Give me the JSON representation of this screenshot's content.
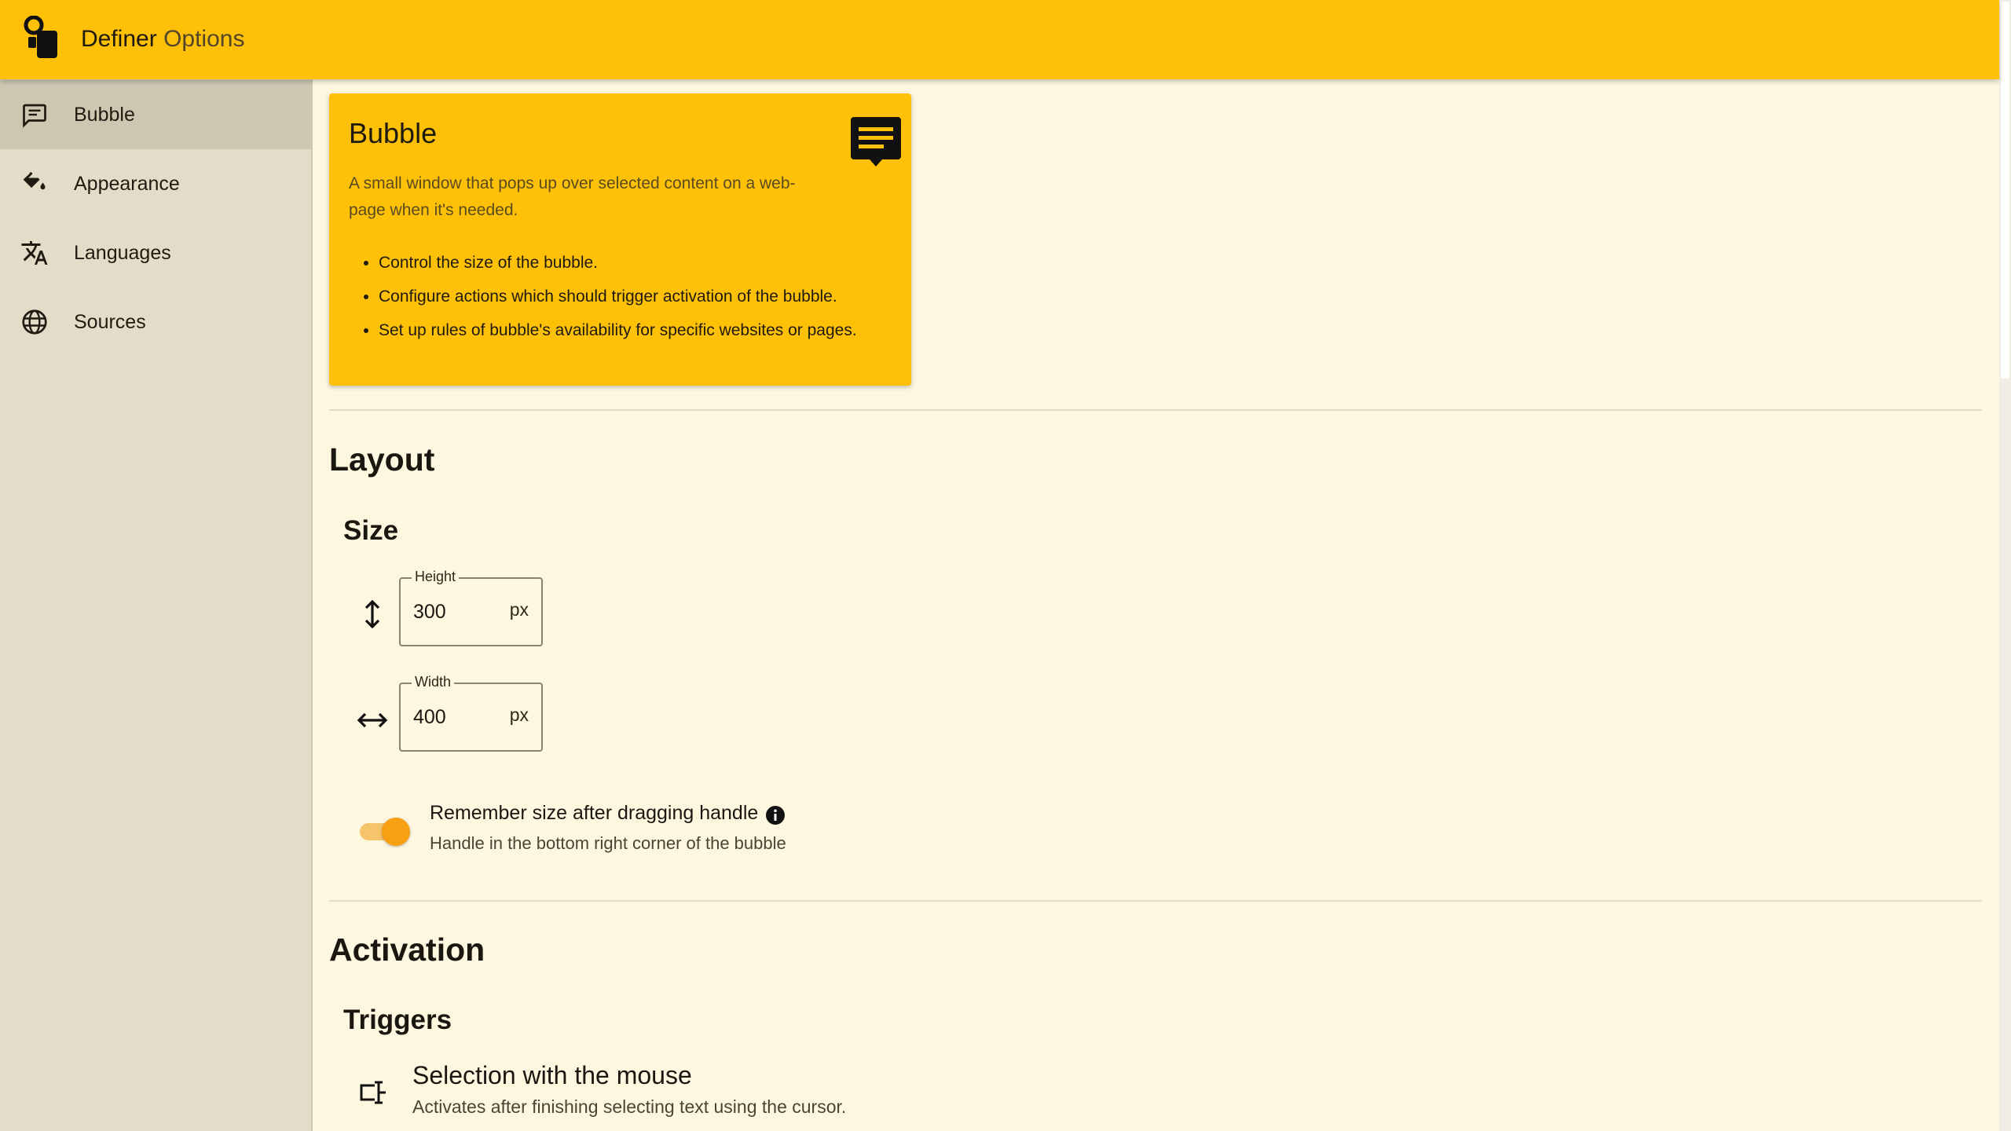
{
  "app": {
    "name": "Definer",
    "section": "Options"
  },
  "sidebar": {
    "items": [
      {
        "label": "Bubble",
        "icon": "chat-bubble-icon",
        "active": true
      },
      {
        "label": "Appearance",
        "icon": "paint-bucket-icon",
        "active": false
      },
      {
        "label": "Languages",
        "icon": "translate-icon",
        "active": false
      },
      {
        "label": "Sources",
        "icon": "globe-icon",
        "active": false
      }
    ]
  },
  "intro": {
    "title": "Bubble",
    "description": "A small window that pops up over selected content on a web-page when it's needed.",
    "icon": "chat-bubble-icon",
    "bullets": [
      "Control the size of the bubble.",
      "Configure actions which should trigger activation of the bubble.",
      "Set up rules of bubble's availability for specific websites or pages."
    ]
  },
  "layout": {
    "heading": "Layout",
    "size": {
      "heading": "Size",
      "height": {
        "label": "Height",
        "value": "300",
        "unit": "px",
        "icon": "vertical-arrows-icon"
      },
      "width": {
        "label": "Width",
        "value": "400",
        "unit": "px",
        "icon": "horizontal-arrows-icon"
      }
    },
    "remember": {
      "label": "Remember size after dragging handle",
      "description": "Handle in the bottom right corner of the bubble",
      "enabled": true,
      "info_icon": "info-icon"
    }
  },
  "activation": {
    "heading": "Activation",
    "triggers": {
      "heading": "Triggers",
      "items": [
        {
          "title": "Selection with the mouse",
          "description": "Activates after finishing selecting text using the cursor.",
          "icon": "text-select-icon"
        }
      ]
    }
  },
  "colors": {
    "accent": "#ffc107",
    "background": "#fef7e0",
    "sidebar": "#e2dcc8",
    "sidebar_active": "#cec6b1",
    "toggle_thumb": "#f7a012"
  }
}
